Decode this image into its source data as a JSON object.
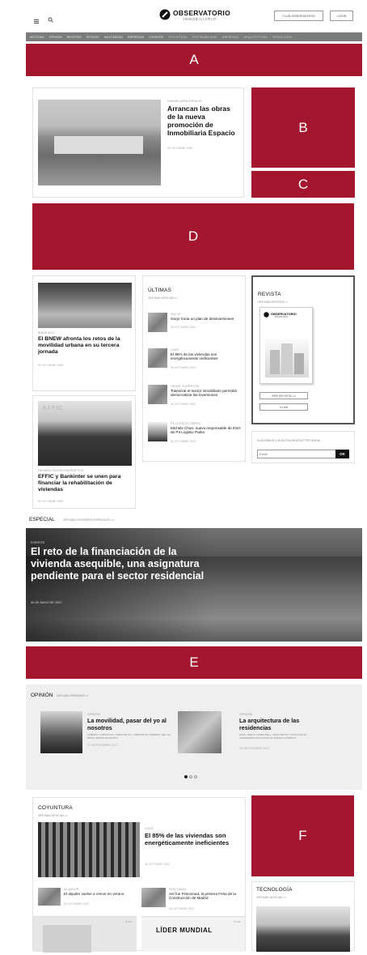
{
  "header": {
    "logo_main": "OBSERVATORIO",
    "logo_sub": "INMOBILIARIO",
    "club_button": "CLUB OBSERVATORIO",
    "login_button": "LOGIN",
    "menu_icon": "menu-icon",
    "search_icon": "search-icon"
  },
  "nav": {
    "items": [
      "NOTICIAS",
      "OPINIÓN",
      "REVISTAS",
      "SEGURO",
      "MULTIMEDIA",
      "EMPRESAS",
      "EVENTOS",
      "COYUNTURA",
      "SOSTENIBILIDAD",
      "EMPRESAS",
      "ARQUITECTURA",
      "TECNOLOGÍA"
    ]
  },
  "ads": {
    "a": "A",
    "b": "B",
    "c": "C",
    "d": "D",
    "e": "E",
    "f": "F"
  },
  "featured": {
    "kicker": "INMOBILIARIA ESPACIO",
    "title": "Arrancan las obras de la nueva promoción de Inmobiliaria Espacio",
    "date": "06 OCTUBRE 2022"
  },
  "left_articles": [
    {
      "kicker": "BNEW 2022",
      "title": "El BNEW afronta los retos de la movilidad urbana en su tercera jornada",
      "date": "06 OCTUBRE 2022"
    },
    {
      "kicker": "REHABILITACIÓN ENERGÉTICA",
      "title": "EFFIC y Bankinter se unen para financiar la rehabilitación de viviendas",
      "date": "06 OCTUBRE 2022"
    }
  ],
  "ultimas": {
    "title": "ÚLTIMAS",
    "see_more": "VER MÁS NOTICIAS >>",
    "items": [
      {
        "kicker": "SACYR",
        "title": "Sacyr inicia un plan de desinversiones",
        "date": "06 OCTUBRE 2022"
      },
      {
        "kicker": "LIGHT",
        "title": "El 85% de las viviendas son energéticamente ineficientes",
        "date": "06 OCTUBRE 2022"
      },
      {
        "kicker": "GRANT THORNTON",
        "title": "Tokenizar el sector inmobiliario permitirá democratizar las inversiones",
        "date": "06 OCTUBRE 2022"
      },
      {
        "kicker": "P3 LOGISTIC PARKS",
        "title": "Michele Chan, nueva responsable de ESG de P3 Logistic Parks",
        "date": "06 OCTUBRE 2022"
      }
    ]
  },
  "revista": {
    "title": "REVISTA",
    "see_more": "VER MÁS REVISTAS >>",
    "cover_logo": "OBSERVATORIO",
    "cover_sub": "INMOBILIARIO",
    "button_view": "VER REVISTA >>",
    "button_club": "CLUB"
  },
  "newsletter": {
    "label": "SUSCRÍBASE A NUESTRA NEWSLETTER DIARIA",
    "placeholder": "Email",
    "button": "OK"
  },
  "especial": {
    "title": "ESPECIAL",
    "see_more": "VER MÁS DOSSIERES ESPECIALES >>",
    "kicker": "EVENTOS",
    "headline": "El reto de la financiación de la vivienda asequible, una asignatura pendiente para el sector residencial",
    "date": "30 DE MAYO DE 2022"
  },
  "opinion": {
    "title": "OPINIÓN",
    "see_more": "VER MÁS OPINIONES >>",
    "items": [
      {
        "kicker": "OPINIÓN",
        "title": "La movilidad, pasar del yo al nosotros",
        "author": "ALBERTO LOBOSCHOT, ARQUITECTO Y URBANISTA. MIEMBRO DEL 1J2 BRAIN SENIOR ADVISORS",
        "date": "27 SEPTIEMBRE 2022"
      },
      {
        "kicker": "OPINIÓN",
        "title": "La arquitectura de las residencias",
        "author": "MARC TEENIT CARBONELL, ARQUITECTO Y SOCIO DE SS INGENIERÍAS APLICANDO EL MODELO NÓRDICO",
        "date": "20 SEPTIEMBRE 2022"
      }
    ]
  },
  "coyuntura": {
    "title": "COYUNTURA",
    "see_more": "VER MÁS NOTICIAS >>",
    "main": {
      "kicker": "LIGHT",
      "title": "El 85% de las viviendas son energéticamente ineficientes",
      "date": "06 OCTUBRE 2022"
    },
    "small": [
      {
        "kicker": "ALQUILER",
        "title": "El alquiler vuelve a crecer en verano",
        "date": "05 OCTUBRE 2022"
      },
      {
        "kicker": "FESCOMAD",
        "title": "Así fue Fescomad, la primera Feria de la Construcción de Madrid",
        "date": "05 OCTUBRE 2022"
      }
    ]
  },
  "tecnologia": {
    "title": "TECNOLOGÍA",
    "see_more": "VER MÁS NOTICIAS >>"
  },
  "bottom_cards": [
    {
      "tag": "PLAN"
    },
    {
      "tag": "PLAN",
      "title": "LÍDER MUNDIAL"
    }
  ]
}
